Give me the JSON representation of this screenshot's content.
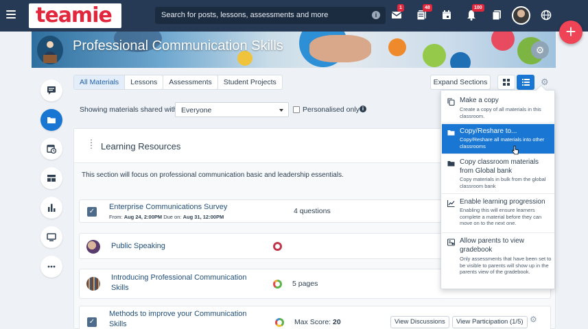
{
  "app": {
    "logo_text": "teamie",
    "brand_color": "#e2263b",
    "topbar_color": "#263a55",
    "accent": "#1976d2"
  },
  "search": {
    "placeholder": "Search for posts, lessons, assessments and more"
  },
  "topbar": {
    "icons": [
      {
        "name": "mail-icon",
        "badge": "1"
      },
      {
        "name": "posts-icon",
        "badge": "48"
      },
      {
        "name": "calendar-icon",
        "badge": ""
      },
      {
        "name": "bell-icon",
        "badge": "100"
      },
      {
        "name": "documents-icon",
        "badge": ""
      },
      {
        "name": "globe-icon",
        "badge": ""
      }
    ],
    "fab_label": "+"
  },
  "banner": {
    "title": "Professional Communication Skills"
  },
  "sidebar": {
    "items": [
      {
        "name": "sidebar-item-messages",
        "icon": "chat-icon"
      },
      {
        "name": "sidebar-item-materials",
        "icon": "folder-icon",
        "active": true
      },
      {
        "name": "sidebar-item-schedule",
        "icon": "calendar-clock-icon"
      },
      {
        "name": "sidebar-item-dashboard",
        "icon": "dashboard-icon"
      },
      {
        "name": "sidebar-item-analytics",
        "icon": "bar-chart-icon"
      },
      {
        "name": "sidebar-item-display",
        "icon": "monitor-icon"
      },
      {
        "name": "sidebar-item-more",
        "icon": "more-icon"
      }
    ]
  },
  "tabs": [
    {
      "label": "All Materials",
      "active": true
    },
    {
      "label": "Lessons"
    },
    {
      "label": "Assessments"
    },
    {
      "label": "Student Projects"
    }
  ],
  "toolbar": {
    "expand_label": "Expand Sections"
  },
  "filter": {
    "label": "Showing materials shared with",
    "selected": "Everyone",
    "checkbox_label": "Personalised only",
    "checkbox_checked": false
  },
  "section": {
    "title": "Learning Resources",
    "description": "This section will focus on professional communication basic and leadership essentials.",
    "items": [
      {
        "title": "Enterprise Communications Survey",
        "from_label": "From:",
        "from": "Aug 24, 2:00PM",
        "due_label": "Due on:",
        "due": "Aug 31, 12:00PM",
        "detail": "4 questions"
      },
      {
        "title": "Public Speaking",
        "detail": ""
      },
      {
        "title": "Introducing Professional Communication Skills",
        "detail": "5 pages"
      },
      {
        "title": "Methods to improve your Communication Skills",
        "detail_label": "Max Score:",
        "detail_value": "20",
        "btn1": "View Discussions",
        "btn2": "View Participation (1/5)"
      }
    ]
  },
  "menu": {
    "items": [
      {
        "title": "Make a copy",
        "desc": "Create a copy of all materials in this classroom.",
        "icon": "copy-icon"
      },
      {
        "title": "Copy/Reshare to...",
        "desc": "Copy/Reshare all materials into other classrooms",
        "icon": "folder-icon",
        "selected": true
      },
      {
        "title": "Copy classroom materials from Global bank",
        "desc": "Copy materials in bulk from the global classroom bank",
        "icon": "folder-icon"
      },
      {
        "title": "Enable learning progression",
        "desc": "Enabling this will ensure learners complete a material before they can move on to the next one.",
        "icon": "progression-icon"
      },
      {
        "title": "Allow parents to view gradebook",
        "desc": "Only assessments that have been set to be visible to parents will show up in the parents view of the gradebook.",
        "icon": "gradebook-icon"
      }
    ]
  }
}
